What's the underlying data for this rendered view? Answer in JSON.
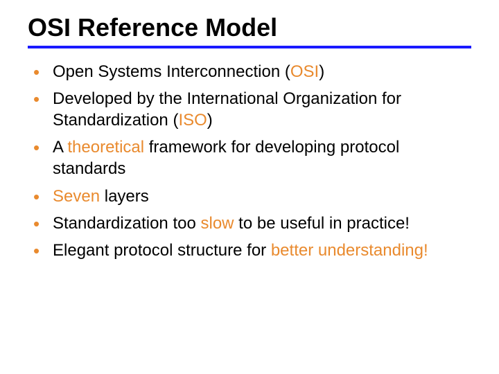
{
  "title": "OSI Reference Model",
  "bullets": [
    {
      "pre": "Open Systems Interconnection (",
      "hl": "OSI",
      "post": ")"
    },
    {
      "pre": "Developed by the International Organization for Standardization (",
      "hl": "ISO",
      "post": ")"
    },
    {
      "pre": "A ",
      "hl": "theoretical",
      "post": " framework for developing protocol standards"
    },
    {
      "pre": "",
      "hl": "Seven",
      "post": " layers"
    },
    {
      "pre": "Standardization too ",
      "hl": "slow",
      "post": " to be useful in practice!"
    },
    {
      "pre": "Elegant protocol structure for ",
      "hl": "better understanding",
      "post": "",
      "postHl": "!"
    }
  ]
}
